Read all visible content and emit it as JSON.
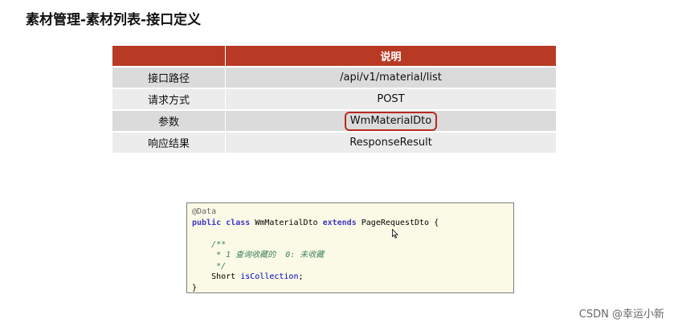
{
  "page": {
    "title": "素材管理-素材列表-接口定义"
  },
  "table": {
    "header": [
      "",
      "说明"
    ],
    "rows": [
      {
        "label": "接口路径",
        "value": "/api/v1/material/list"
      },
      {
        "label": "请求方式",
        "value": "POST"
      },
      {
        "label": "参数",
        "value": "WmMaterialDto"
      },
      {
        "label": "响应结果",
        "value": "ResponseResult"
      }
    ]
  },
  "code": {
    "line1": "@Data",
    "line2_kw1": "public",
    "line2_kw2": "class",
    "line2_name": " WmMaterialDto ",
    "line2_kw3": "extends",
    "line2_rest": " PageRequestDto {",
    "line4": "    /**",
    "line5": "     * 1 查询收藏的  0: 未收藏",
    "line6": "     */",
    "line7_type": "    Short ",
    "line7_field": "isCollection",
    "line7_end": ";",
    "line8": "}"
  },
  "watermark": "CSDN @幸运小新",
  "colors": {
    "header_bg": "#b83a24",
    "highlight_border": "#b52b22",
    "code_bg": "#fafae6"
  }
}
